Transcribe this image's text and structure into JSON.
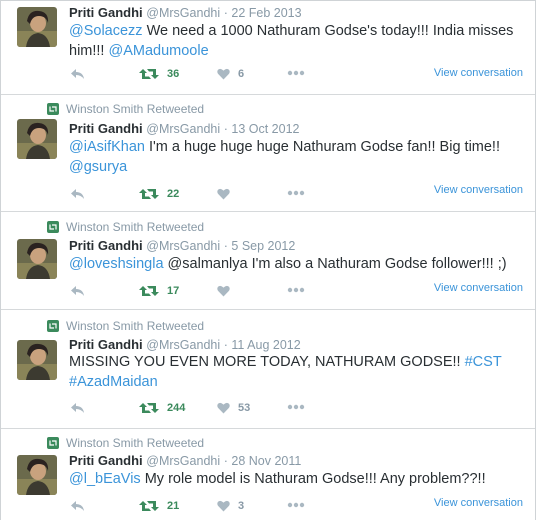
{
  "tweets": [
    {
      "retweeted_by": "",
      "name": "Priti Gandhi",
      "handle": "@MrsGandhi",
      "date": "22 Feb 2013",
      "segments": [
        {
          "text": "@Solacezz",
          "link": true
        },
        {
          "text": " We need a 1000 Nathuram Godse's today!!! India misses him!!! ",
          "link": false
        },
        {
          "text": "@AMadumoole",
          "link": true
        }
      ],
      "retweets": "36",
      "favorites": "6",
      "view_conversation": "View conversation"
    },
    {
      "retweeted_by": "Winston Smith Retweeted",
      "name": "Priti Gandhi",
      "handle": "@MrsGandhi",
      "date": "13 Oct 2012",
      "segments": [
        {
          "text": "@iAsifKhan",
          "link": true
        },
        {
          "text": " I'm a huge huge huge Nathuram Godse fan!! Big time!! ",
          "link": false
        },
        {
          "text": "@gsurya",
          "link": true
        }
      ],
      "retweets": "22",
      "favorites": "",
      "view_conversation": "View conversation"
    },
    {
      "retweeted_by": "Winston Smith Retweeted",
      "name": "Priti Gandhi",
      "handle": "@MrsGandhi",
      "date": "5 Sep 2012",
      "segments": [
        {
          "text": "@loveshsingla",
          "link": true
        },
        {
          "text": " @salmanlya I'm also a Nathuram Godse follower!!! ;)",
          "link": false
        }
      ],
      "retweets": "17",
      "favorites": "",
      "view_conversation": "View conversation"
    },
    {
      "retweeted_by": "Winston Smith Retweeted",
      "name": "Priti Gandhi",
      "handle": "@MrsGandhi",
      "date": "11 Aug 2012",
      "segments": [
        {
          "text": "MISSING YOU EVEN MORE TODAY, NATHURAM GODSE!! ",
          "link": false
        },
        {
          "text": "#CST",
          "link": true
        },
        {
          "text": " ",
          "link": false
        },
        {
          "text": "#AzadMaidan",
          "link": true
        }
      ],
      "retweets": "244",
      "favorites": "53",
      "view_conversation": ""
    },
    {
      "retweeted_by": "Winston Smith Retweeted",
      "name": "Priti Gandhi",
      "handle": "@MrsGandhi",
      "date": "28 Nov 2011",
      "segments": [
        {
          "text": "@l_bEaVis",
          "link": true
        },
        {
          "text": " My role model is Nathuram Godse!!! Any problem??!!",
          "link": false
        }
      ],
      "retweets": "21",
      "favorites": "3",
      "view_conversation": "View conversation"
    }
  ],
  "icons": {
    "reply": "reply-icon",
    "retweet": "retweet-icon",
    "favorite": "heart-icon",
    "more": "more-icon",
    "retweeted": "retweeted-icon"
  },
  "colors": {
    "link": "#3b94d9",
    "muted": "#8899a6",
    "retweet_green": "#3b8a5c",
    "border": "#d6d9db"
  }
}
